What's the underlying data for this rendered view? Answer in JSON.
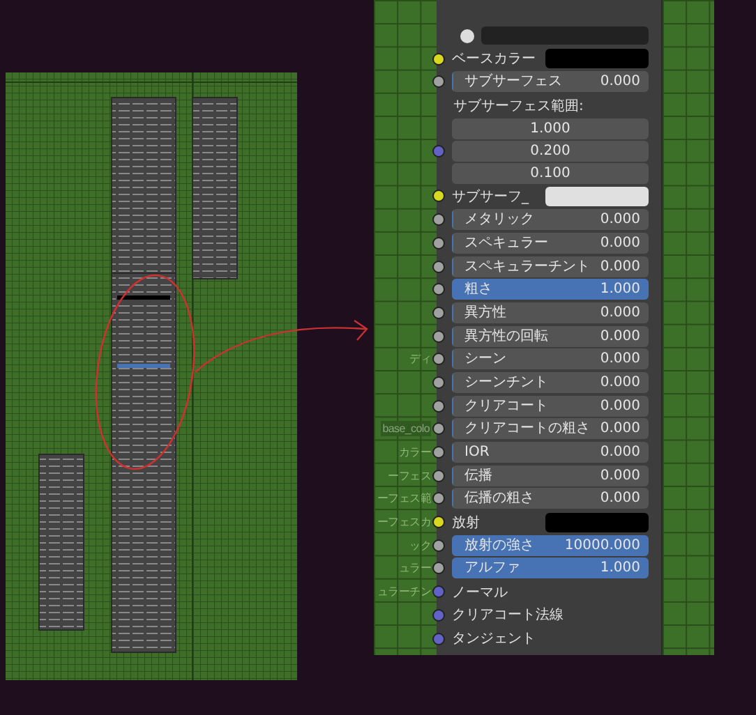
{
  "inputs": [
    {
      "kind": "color",
      "label": "ベースカラー",
      "color": "#000000"
    },
    {
      "kind": "value",
      "label": "サブサーフェス",
      "value": "0.000",
      "level": 0
    },
    {
      "kind": "label",
      "label": "サブサーフェス範囲:"
    },
    {
      "kind": "vector",
      "values": [
        "1.000",
        "0.200",
        "0.100"
      ]
    },
    {
      "kind": "color",
      "label": "サブサーフ_",
      "color": "#e0e0e0"
    },
    {
      "kind": "value",
      "label": "メタリック",
      "value": "0.000",
      "level": 0
    },
    {
      "kind": "value",
      "label": "スペキュラー",
      "value": "0.000",
      "level": 0
    },
    {
      "kind": "value",
      "label": "スペキュラーチント",
      "value": "0.000",
      "level": 0
    },
    {
      "kind": "value",
      "label": "粗さ",
      "value": "1.000",
      "level": 1
    },
    {
      "kind": "value",
      "label": "異方性",
      "value": "0.000",
      "level": 0
    },
    {
      "kind": "value",
      "label": "異方性の回転",
      "value": "0.000",
      "level": 0
    },
    {
      "kind": "value",
      "label": "シーン",
      "value": "0.000",
      "level": 0,
      "background_label": {
        "text": "ディ",
        "boxed": false
      }
    },
    {
      "kind": "value",
      "label": "シーンチント",
      "value": "0.000",
      "level": 0
    },
    {
      "kind": "value",
      "label": "クリアコート",
      "value": "0.000",
      "level": 0
    },
    {
      "kind": "value",
      "label": "クリアコートの粗さ",
      "value": "0.000",
      "level": 0,
      "background_label": {
        "text": "base_colo",
        "boxed": true
      }
    },
    {
      "kind": "value",
      "label": "IOR",
      "value": "0.000",
      "level": 0,
      "background_label": {
        "text": "カラー",
        "boxed": false
      }
    },
    {
      "kind": "value",
      "label": "伝播",
      "value": "0.000",
      "level": 0,
      "background_label": {
        "text": "ーフェス",
        "boxed": false
      }
    },
    {
      "kind": "value",
      "label": "伝播の粗さ",
      "value": "0.000",
      "level": 0,
      "background_label": {
        "text": "ーフェス範",
        "boxed": false
      }
    },
    {
      "kind": "color",
      "label": "放射",
      "color": "#000000",
      "background_label": {
        "text": "ーフェスカ",
        "boxed": false
      }
    },
    {
      "kind": "value",
      "label": "放射の強さ",
      "value": "10000.000",
      "level": 1,
      "background_label": {
        "text": "ック",
        "boxed": false
      }
    },
    {
      "kind": "value",
      "label": "アルファ",
      "value": "1.000",
      "level": 1,
      "background_label": {
        "text": "ュラー",
        "boxed": false
      }
    },
    {
      "kind": "socket",
      "label": "ノーマル",
      "background_label": {
        "text": "ュラーチン",
        "boxed": false
      }
    },
    {
      "kind": "socket",
      "label": "クリアコート法線"
    },
    {
      "kind": "socket",
      "label": "タンジェント"
    }
  ]
}
